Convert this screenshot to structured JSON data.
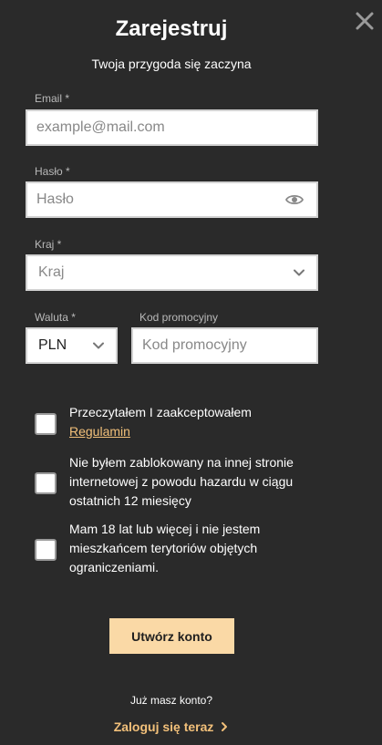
{
  "modal": {
    "title": "Zarejestruj",
    "subtitle": "Twoja przygoda się zaczyna",
    "close_icon": "close-icon"
  },
  "form": {
    "email": {
      "label": "Email *",
      "placeholder": "example@mail.com",
      "value": ""
    },
    "password": {
      "label": "Hasło *",
      "placeholder": "Hasło",
      "value": "",
      "toggle_icon": "eye-icon"
    },
    "country": {
      "label": "Kraj *",
      "selected": "Kraj",
      "icon": "chevron-down-icon"
    },
    "currency": {
      "label": "Waluta *",
      "selected": "PLN",
      "icon": "chevron-down-icon"
    },
    "promo": {
      "label": "Kod promocyjny",
      "placeholder": "Kod promocyjny",
      "value": ""
    }
  },
  "checkboxes": {
    "terms": {
      "text": "Przeczytałem I zaakceptowałem",
      "link": "Regulamin",
      "checked": false
    },
    "not_blocked": {
      "text": "Nie byłem zablokowany na innej stronie internetowej z powodu hazardu w ciągu ostatnich 12 miesięcy",
      "checked": false
    },
    "age": {
      "text": "Mam 18 lat lub więcej i nie jestem mieszkańcem terytoriów objętych ograniczeniami.",
      "checked": false
    }
  },
  "submit_label": "Utwórz konto",
  "footer": {
    "question": "Już masz konto?",
    "login_label": "Zaloguj się teraz",
    "login_icon": "chevron-right-icon"
  },
  "colors": {
    "background": "#2a2a2a",
    "accent": "#f2c07a",
    "button": "#fad9a6"
  }
}
